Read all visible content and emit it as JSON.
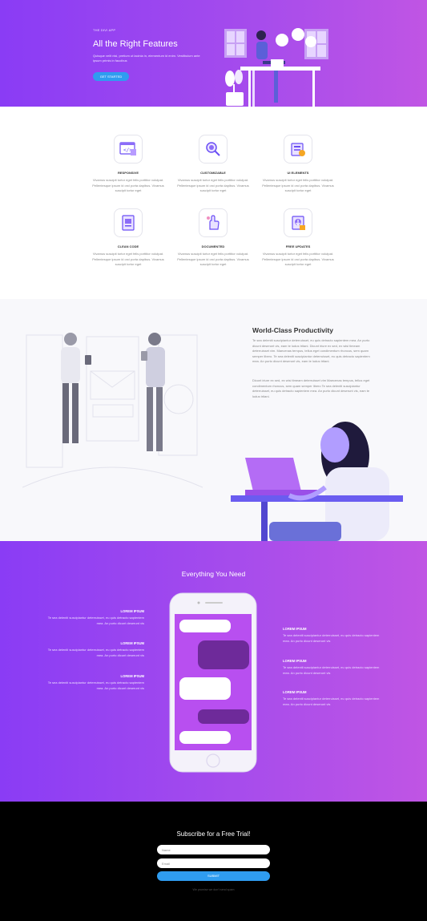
{
  "hero": {
    "eyebrow": "THE DIVI APP",
    "title": "All the Right Features",
    "subtitle": "Quisque velit nisi, pretium ut lacinia in, elementum id enim. Vestibulum ante ipsum primis in faucibus",
    "cta": "GET STARTED"
  },
  "features": [
    {
      "title": "RESPONSIVE",
      "desc": "Vivamus suscipit tortor eget felis porttitor volutpat. Pellentesque ipsum id orci porta dapibus. Vivamus suscipit tortor eget",
      "icon": "code-window-icon"
    },
    {
      "title": "CUSTOMIZABLE",
      "desc": "Vivamus suscipit tortor eget felis porttitor volutpat. Pellentesque ipsum id orci porta dapibus. Vivamus suscipit tortor eget",
      "icon": "magnifier-icon"
    },
    {
      "title": "UI ELEMENTS",
      "desc": "Vivamus suscipit tortor eget felis porttitor volutpat. Pellentesque ipsum id orci porta dapibus. Vivamus suscipit tortor eget",
      "icon": "ui-elements-icon"
    },
    {
      "title": "CLEAN CODE",
      "desc": "Vivamus suscipit tortor eget felis porttitor volutpat. Pellentesque ipsum id orci porta dapibus. Vivamus suscipit tortor eget",
      "icon": "document-icon"
    },
    {
      "title": "DOCUMENTED",
      "desc": "Vivamus suscipit tortor eget felis porttitor volutpat. Pellentesque ipsum id orci porta dapibus. Vivamus suscipit tortor eget",
      "icon": "hand-gesture-icon"
    },
    {
      "title": "FREE UPDATES",
      "desc": "Vivamus suscipit tortor eget felis porttitor volutpat. Pellentesque ipsum id orci porta dapibus. Vivamus suscipit tortor eget",
      "icon": "download-icon"
    }
  ],
  "productivity": {
    "title": "World-Class Productivity",
    "p1": "Te sea deleniti suscipiantur deterruisset, eu quis detracto sapientem mea. An purto dicunt deserunt vis, eam te ludus tritani. Dicunt iriure ex sed, ex wisi timeam deterruisset vim. Maecenas tempus, tellus eget condimentum rhoncus, sem quam semper libero. Te sea deleniti suscipiantur deterruisset, eu quis detracto sapientem mea. An purto dicunt deserunt vis, eam te ludus tritani.",
    "p2": "Dicunt iriure ex sed, ex wisi timeam deterruisset vim Maecenas tempus, tellus eget condimentum rhoncus, sem quam semper libero Te sea deleniti suscipiantur deterruisset, eu quis detracto sapientem mea. An purto dicunt deserunt vis, eam te ludus tritani."
  },
  "everything": {
    "title": "Everything You Need",
    "left": [
      {
        "title": "LOREM IPSUM",
        "desc": "Te sea deleniti suscipiantur deterruisset, eu quis detracto sapientem mea. An purto dicunt deserunt vis"
      },
      {
        "title": "LOREM IPSUM",
        "desc": "Te sea deleniti suscipiantur deterruisset, eu quis detracto sapientem mea. An purto dicunt deserunt vis"
      },
      {
        "title": "LOREM IPSUM",
        "desc": "Te sea deleniti suscipiantur deterruisset, eu quis detracto sapientem mea. An purto dicunt deserunt vis"
      }
    ],
    "right": [
      {
        "title": "LOREM IPSUM",
        "desc": "Te sea deleniti suscipiantur deterruisset, eu quis detracto sapientem mea. An purto dicunt deserunt vis"
      },
      {
        "title": "LOREM IPSUM",
        "desc": "Te sea deleniti suscipiantur deterruisset, eu quis detracto sapientem mea. An purto dicunt deserunt vis"
      },
      {
        "title": "LOREM IPSUM",
        "desc": "Te sea deleniti suscipiantur deterruisset, eu quis detracto sapientem mea. An purto dicunt deserunt vis"
      }
    ]
  },
  "subscribe": {
    "title": "Subscribe for a Free Trial!",
    "name_placeholder": "Name",
    "email_placeholder": "Email",
    "submit": "SUBMIT",
    "note": "We promise we don't send spam"
  },
  "colors": {
    "purple": "#8a3cf5",
    "magenta": "#c055e4",
    "blue": "#2f9cf0",
    "black": "#000000"
  }
}
